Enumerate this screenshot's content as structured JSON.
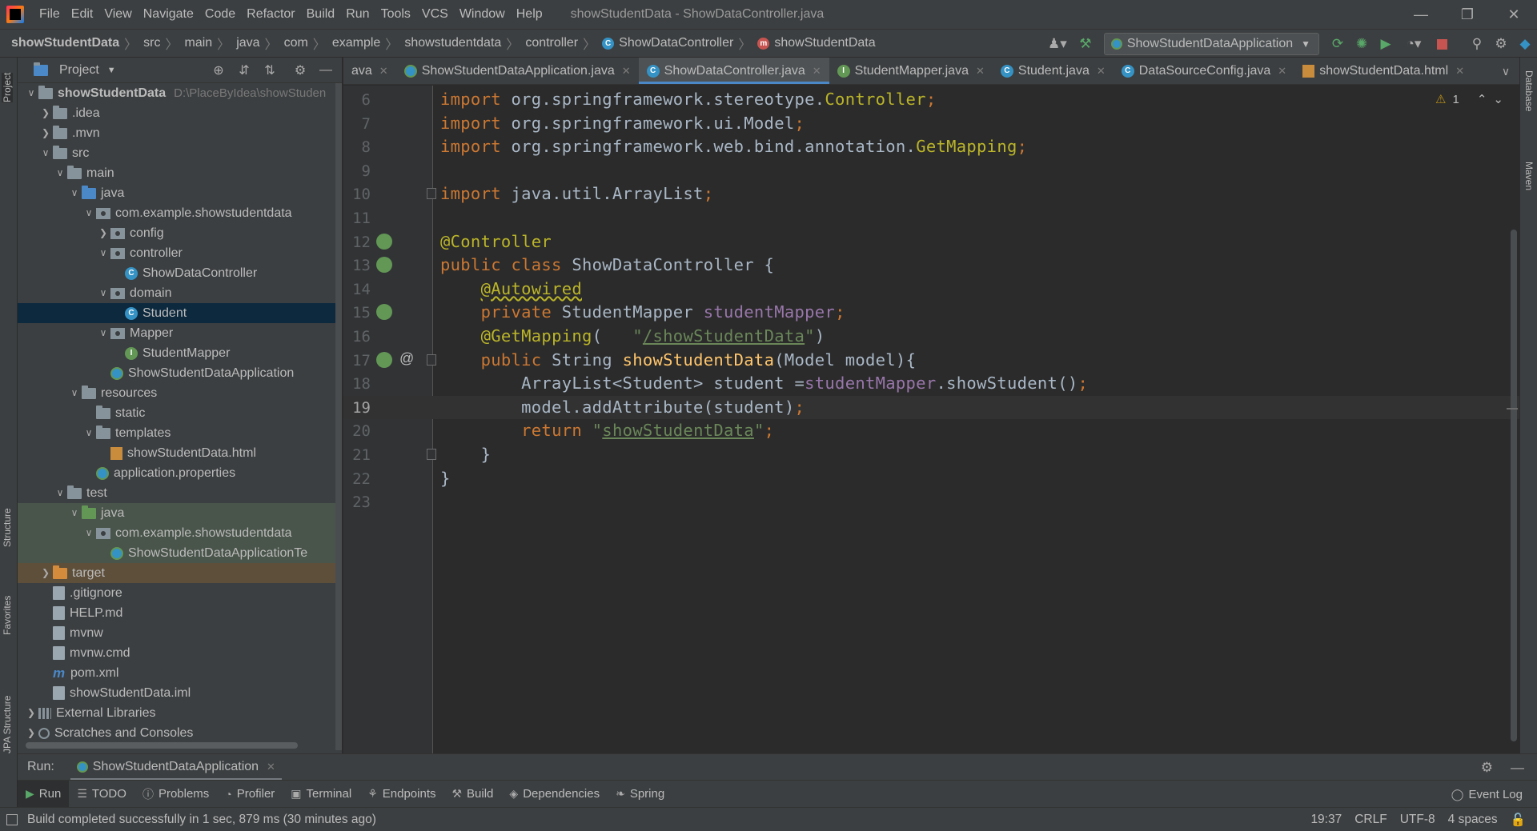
{
  "menubar": {
    "items": [
      "File",
      "Edit",
      "View",
      "Navigate",
      "Code",
      "Refactor",
      "Build",
      "Run",
      "Tools",
      "VCS",
      "Window",
      "Help"
    ],
    "window_title": "showStudentData - ShowDataController.java"
  },
  "navbar": {
    "crumbs": [
      "showStudentData",
      "src",
      "main",
      "java",
      "com",
      "example",
      "showstudentdata",
      "controller"
    ],
    "class_crumb": "ShowDataController",
    "method_crumb": "showStudentData",
    "run_config": "ShowStudentDataApplication"
  },
  "left_stripe": {
    "project": "Project",
    "structure": "Structure",
    "favorites": "Favorites",
    "jpa": "JPA Structure"
  },
  "right_stripe": {
    "database": "Database",
    "maven": "Maven"
  },
  "project_panel": {
    "title": "Project",
    "root_path": "D:\\PlaceByIdea\\showStuden",
    "tree": [
      {
        "label": "showStudentData",
        "depth": 0,
        "kind": "folder",
        "expanded": true
      },
      {
        "label": ".idea",
        "depth": 1,
        "kind": "folder",
        "expanded": false
      },
      {
        "label": ".mvn",
        "depth": 1,
        "kind": "folder",
        "expanded": false
      },
      {
        "label": "src",
        "depth": 1,
        "kind": "folder",
        "expanded": true
      },
      {
        "label": "main",
        "depth": 2,
        "kind": "folder",
        "expanded": true
      },
      {
        "label": "java",
        "depth": 3,
        "kind": "folder-blue",
        "expanded": true
      },
      {
        "label": "com.example.showstudentdata",
        "depth": 4,
        "kind": "package",
        "expanded": true
      },
      {
        "label": "config",
        "depth": 5,
        "kind": "package",
        "expanded": false
      },
      {
        "label": "controller",
        "depth": 5,
        "kind": "package",
        "expanded": true
      },
      {
        "label": "ShowDataController",
        "depth": 6,
        "kind": "class"
      },
      {
        "label": "domain",
        "depth": 5,
        "kind": "package",
        "expanded": true
      },
      {
        "label": "Student",
        "depth": 6,
        "kind": "class",
        "selected": true
      },
      {
        "label": "Mapper",
        "depth": 5,
        "kind": "package",
        "expanded": true
      },
      {
        "label": "StudentMapper",
        "depth": 6,
        "kind": "interface"
      },
      {
        "label": "ShowStudentDataApplication",
        "depth": 5,
        "kind": "spring"
      },
      {
        "label": "resources",
        "depth": 3,
        "kind": "folder",
        "expanded": true
      },
      {
        "label": "static",
        "depth": 4,
        "kind": "folder"
      },
      {
        "label": "templates",
        "depth": 4,
        "kind": "folder",
        "expanded": true
      },
      {
        "label": "showStudentData.html",
        "depth": 5,
        "kind": "html"
      },
      {
        "label": "application.properties",
        "depth": 4,
        "kind": "spring"
      },
      {
        "label": "test",
        "depth": 2,
        "kind": "folder",
        "expanded": true
      },
      {
        "label": "java",
        "depth": 3,
        "kind": "folder-green",
        "expanded": true,
        "test": true
      },
      {
        "label": "com.example.showstudentdata",
        "depth": 4,
        "kind": "package",
        "expanded": true,
        "test": true
      },
      {
        "label": "ShowStudentDataApplicationTe",
        "depth": 5,
        "kind": "spring",
        "test": true
      },
      {
        "label": "target",
        "depth": 1,
        "kind": "folder-orange",
        "expanded": false,
        "target": true
      },
      {
        "label": ".gitignore",
        "depth": 1,
        "kind": "file"
      },
      {
        "label": "HELP.md",
        "depth": 1,
        "kind": "file"
      },
      {
        "label": "mvnw",
        "depth": 1,
        "kind": "file"
      },
      {
        "label": "mvnw.cmd",
        "depth": 1,
        "kind": "file"
      },
      {
        "label": "pom.xml",
        "depth": 1,
        "kind": "maven"
      },
      {
        "label": "showStudentData.iml",
        "depth": 1,
        "kind": "file"
      },
      {
        "label": "External Libraries",
        "depth": 0,
        "kind": "lib",
        "expanded": false
      },
      {
        "label": "Scratches and Consoles",
        "depth": 0,
        "kind": "scratch",
        "expanded": false
      }
    ]
  },
  "editor_tabs": [
    {
      "label": "ava",
      "kind": "spring",
      "partial": true
    },
    {
      "label": "ShowStudentDataApplication.java",
      "kind": "spring"
    },
    {
      "label": "ShowDataController.java",
      "kind": "class",
      "active": true
    },
    {
      "label": "StudentMapper.java",
      "kind": "interface"
    },
    {
      "label": "Student.java",
      "kind": "class"
    },
    {
      "label": "DataSourceConfig.java",
      "kind": "class"
    },
    {
      "label": "showStudentData.html",
      "kind": "html"
    }
  ],
  "editor": {
    "warnings": "1",
    "current_line": 19,
    "lines": [
      {
        "n": "6",
        "segs": [
          [
            "kw",
            "import "
          ],
          [
            "",
            "org.springframework.stereotype."
          ],
          [
            "ann",
            "Controller"
          ],
          [
            "kw",
            ";"
          ]
        ]
      },
      {
        "n": "7",
        "segs": [
          [
            "kw",
            "import "
          ],
          [
            "",
            "org.springframework.ui.Model"
          ],
          [
            "kw",
            ";"
          ]
        ]
      },
      {
        "n": "8",
        "segs": [
          [
            "kw",
            "import "
          ],
          [
            "",
            "org.springframework.web.bind.annotation."
          ],
          [
            "ann",
            "GetMapping"
          ],
          [
            "kw",
            ";"
          ]
        ]
      },
      {
        "n": "9",
        "segs": []
      },
      {
        "n": "10",
        "segs": [
          [
            "kw",
            "import "
          ],
          [
            "",
            "java.util.ArrayList"
          ],
          [
            "kw",
            ";"
          ]
        ]
      },
      {
        "n": "11",
        "segs": []
      },
      {
        "n": "12",
        "segs": [
          [
            "ann",
            "@Controller"
          ]
        ]
      },
      {
        "n": "13",
        "segs": [
          [
            "kw",
            "public class "
          ],
          [
            "",
            "ShowDataController {"
          ]
        ]
      },
      {
        "n": "14",
        "segs": [
          [
            "",
            "    "
          ],
          [
            "ann wavy",
            "@Autowired"
          ]
        ]
      },
      {
        "n": "15",
        "segs": [
          [
            "",
            "    "
          ],
          [
            "kw",
            "private "
          ],
          [
            "",
            "StudentMapper "
          ],
          [
            "field",
            "studentMapper"
          ],
          [
            "kw",
            ";"
          ]
        ]
      },
      {
        "n": "16",
        "segs": [
          [
            "",
            "    "
          ],
          [
            "ann",
            "@GetMapping"
          ],
          [
            "",
            "("
          ],
          [
            "str",
            "   \""
          ],
          [
            "str ulink",
            "/showStudentData"
          ],
          [
            "str",
            "\""
          ],
          [
            "",
            ")"
          ]
        ]
      },
      {
        "n": "17",
        "segs": [
          [
            "",
            "    "
          ],
          [
            "kw",
            "public "
          ],
          [
            "",
            "String "
          ],
          [
            "method",
            "showStudentData"
          ],
          [
            "",
            "(Model model){"
          ]
        ]
      },
      {
        "n": "18",
        "segs": [
          [
            "",
            "        ArrayList<Student> student ="
          ],
          [
            "field",
            "studentMapper"
          ],
          [
            "",
            ".showStudent()"
          ],
          [
            "kw",
            ";"
          ]
        ]
      },
      {
        "n": "19",
        "segs": [
          [
            "",
            "        model.addAttribute(student)"
          ],
          [
            "kw",
            ";"
          ]
        ]
      },
      {
        "n": "20",
        "segs": [
          [
            "",
            "        "
          ],
          [
            "kw",
            "return "
          ],
          [
            "str",
            "\""
          ],
          [
            "str ulink",
            "showStudentData"
          ],
          [
            "str",
            "\""
          ],
          [
            "kw",
            ";"
          ]
        ]
      },
      {
        "n": "21",
        "segs": [
          [
            "",
            "    }"
          ]
        ]
      },
      {
        "n": "22",
        "segs": [
          [
            "",
            "}"
          ]
        ]
      },
      {
        "n": "23",
        "segs": []
      }
    ]
  },
  "runbar": {
    "label": "Run:",
    "tab": "ShowStudentDataApplication"
  },
  "tool_windows": [
    "Run",
    "TODO",
    "Problems",
    "Profiler",
    "Terminal",
    "Endpoints",
    "Build",
    "Dependencies",
    "Spring"
  ],
  "tool_icons": [
    "▶",
    "☰",
    "ⓘ",
    "◔",
    "▣",
    "⚘",
    "⚒",
    "◈",
    "❧"
  ],
  "event_log": "Event Log",
  "statusbar": {
    "message": "Build completed successfully in 1 sec, 879 ms (30 minutes ago)",
    "position": "19:37",
    "line_sep": "CRLF",
    "encoding": "UTF-8",
    "indent": "4 spaces"
  }
}
